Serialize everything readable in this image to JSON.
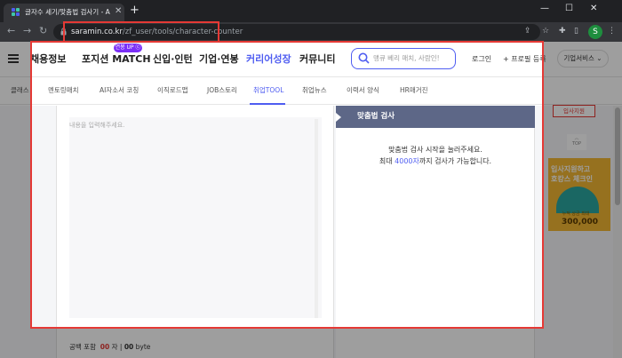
{
  "browser": {
    "tab_title": "글자수 세기/맞춤법 검사기 - AI",
    "tab_close": "✕",
    "new_tab": "+",
    "window_controls": [
      "—",
      "☐",
      "✕"
    ],
    "nav": {
      "back": "←",
      "forward": "→",
      "reload": "↻"
    },
    "url_domain": "saramin.co.kr",
    "url_path": "/zf_user/tools/character-counter",
    "profile_initial": "S",
    "toolbar_icons": [
      "share-icon",
      "star-icon",
      "extensions-icon",
      "sidepanel-icon"
    ]
  },
  "header": {
    "nav_items": [
      "채용정보",
      "포지션 MATCH",
      "신입·인턴",
      "기업·연봉",
      "커리어성장",
      "커뮤니티"
    ],
    "active_item": "커리어성장",
    "promo_badge": "연봉 UP ⓒ",
    "search_placeholder": "맹큐 베리 매치, 사람인!",
    "login": "로그인",
    "profile_register": "+ 프로필 등록",
    "business_service": "기업서비스 ⌄"
  },
  "subnav": {
    "items": [
      "클래스",
      "멘토링매치",
      "AI자소서 코칭",
      "이직로드맵",
      "JOB스토리",
      "취업TOOL",
      "취업뉴스",
      "이력서 양식",
      "HR매거진"
    ],
    "active_item": "취업TOOL"
  },
  "editor": {
    "placeholder": "내용을 입력해주세요.",
    "counter_label": "공백 포함",
    "counter_chars": "00",
    "counter_unit_char": "자",
    "counter_sep": "|",
    "counter_bytes": "00",
    "counter_unit_byte": "byte"
  },
  "spellcheck": {
    "title": "맞춤법 검사",
    "message_line1": "맞춤법 검사 시작을 눌러주세요.",
    "message_line2_prefix": "최대 ",
    "message_line2_highlight": "4000자",
    "message_line2_suffix": "까지 검사가 가능합니다."
  },
  "sidebar": {
    "apply_button": "입사지원",
    "top_button": "TOP",
    "ad_line1": "입사지원하고",
    "ad_line2": "호캉스 체크인",
    "ad_sub": "누적 상금 최대",
    "ad_amount": "300,000"
  },
  "colors": {
    "accent": "#4f5df1",
    "highlight_red": "#e53935",
    "panel_header": "#5d6787"
  }
}
